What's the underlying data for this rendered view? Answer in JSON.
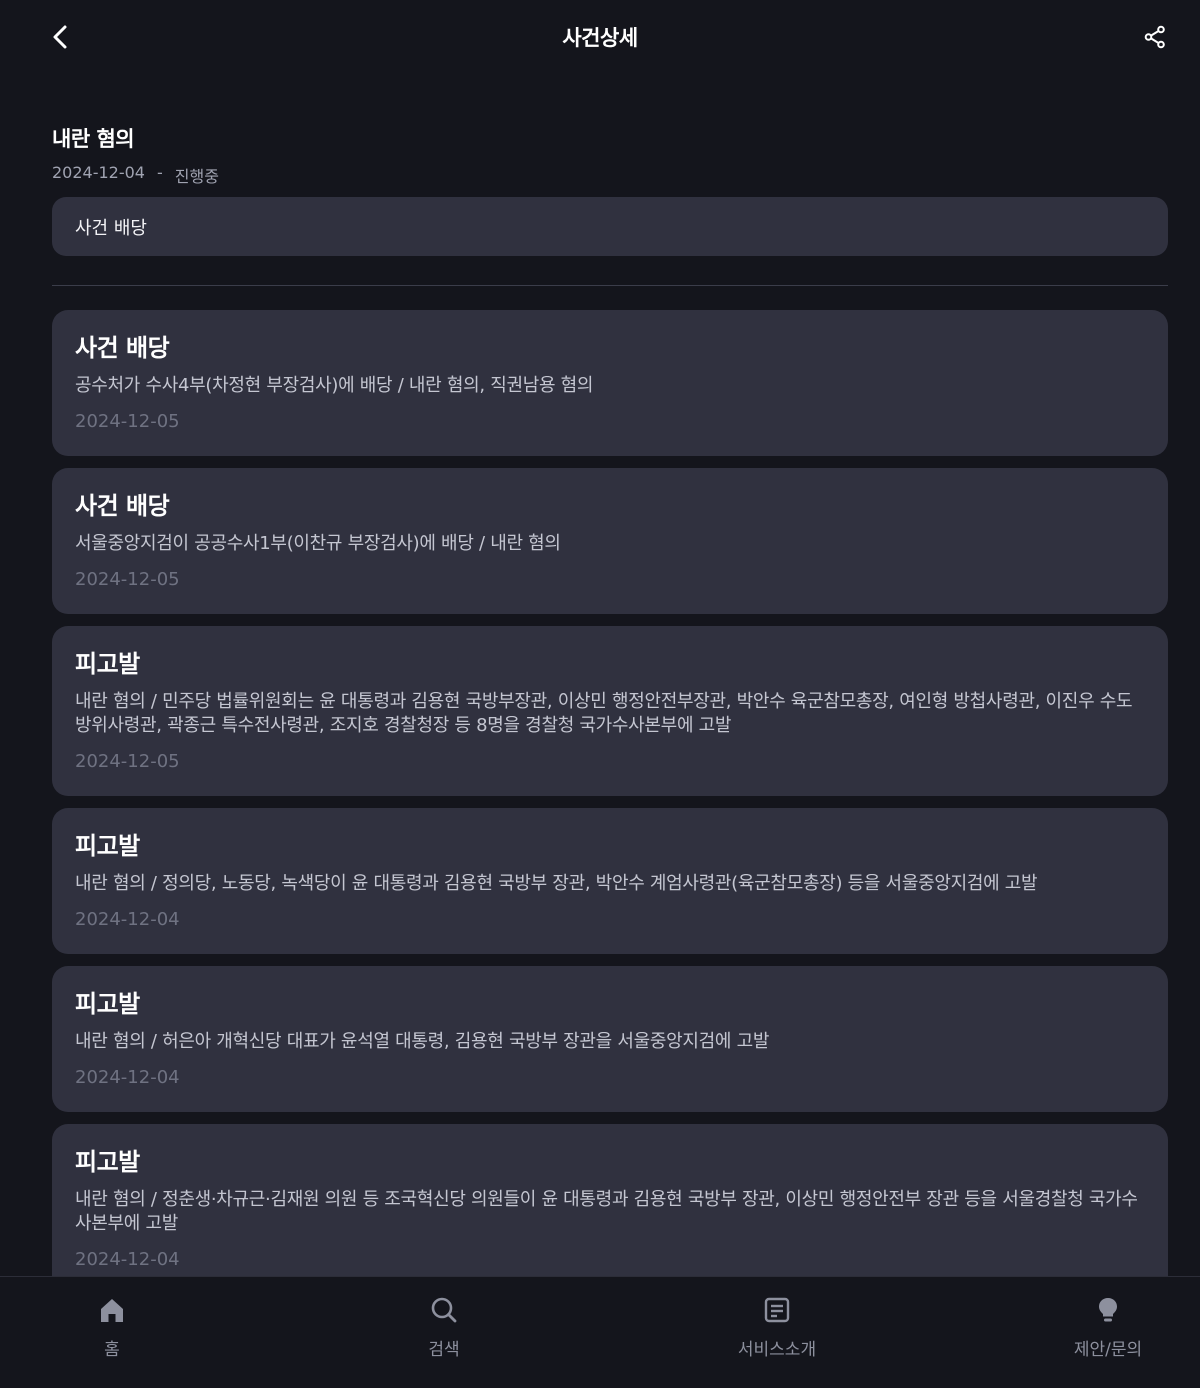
{
  "header": {
    "title": "사건상세"
  },
  "case": {
    "title": "내란 혐의",
    "start_date": "2024-12-04",
    "separator": "-",
    "status": "진행중",
    "latest_event": "사건 배당"
  },
  "events": [
    {
      "type": "사건 배당",
      "description": "공수처가 수사4부(차정현 부장검사)에 배당 / 내란 혐의, 직권남용 혐의",
      "date": "2024-12-05"
    },
    {
      "type": "사건 배당",
      "description": "서울중앙지검이 공공수사1부(이찬규 부장검사)에 배당 / 내란 혐의",
      "date": "2024-12-05"
    },
    {
      "type": "피고발",
      "description": "내란 혐의 / 민주당 법률위원회는 윤 대통령과 김용현 국방부장관, 이상민 행정안전부장관, 박안수 육군참모총장, 여인형 방첩사령관, 이진우 수도방위사령관, 곽종근 특수전사령관, 조지호 경찰청장 등 8명을 경찰청 국가수사본부에 고발",
      "date": "2024-12-05"
    },
    {
      "type": "피고발",
      "description": "내란 혐의 / 정의당, 노동당, 녹색당이 윤 대통령과 김용현 국방부 장관, 박안수 계엄사령관(육군참모총장) 등을 서울중앙지검에 고발",
      "date": "2024-12-04"
    },
    {
      "type": "피고발",
      "description": "내란 혐의 / 허은아 개혁신당 대표가 윤석열 대통령, 김용현 국방부 장관을 서울중앙지검에 고발",
      "date": "2024-12-04"
    },
    {
      "type": "피고발",
      "description": "내란 혐의 / 정춘생·차규근·김재원 의원 등 조국혁신당 의원들이 윤 대통령과 김용현 국방부 장관, 이상민 행정안전부 장관 등을 서울경찰청 국가수사본부에 고발",
      "date": "2024-12-04"
    }
  ],
  "tabbar": [
    {
      "label": "홈",
      "icon": "home-icon"
    },
    {
      "label": "검색",
      "icon": "search-icon"
    },
    {
      "label": "서비스소개",
      "icon": "document-icon"
    },
    {
      "label": "제안/문의",
      "icon": "lightbulb-icon"
    }
  ],
  "colors": {
    "background": "#14151c",
    "card": "#30313f",
    "muted": "#6f7282"
  }
}
